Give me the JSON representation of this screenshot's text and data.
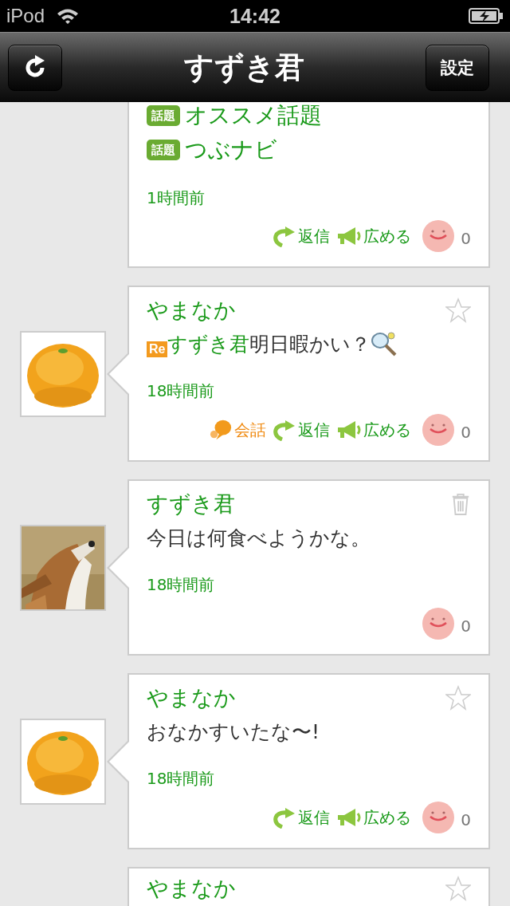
{
  "status_bar": {
    "carrier": "iPod",
    "time": "14:42"
  },
  "nav_bar": {
    "title": "すずき君",
    "settings_button": "設定"
  },
  "posts": [
    {
      "kind": "partial_top",
      "topics": [
        {
          "badge": "話題",
          "label": "オススメ話題"
        },
        {
          "badge": "話題",
          "label": "つぶナビ"
        }
      ],
      "time": "1時間前",
      "actions": [
        {
          "kind": "reply",
          "label": "返信"
        },
        {
          "kind": "spread",
          "label": "広める"
        }
      ],
      "likes": "0"
    },
    {
      "kind": "post",
      "author": "やまなか",
      "starred": false,
      "avatar": {
        "kind": "picture"
      },
      "re_badge": "Re",
      "reply_to": "すずき君",
      "text": "明日暇かい？",
      "racket_emoji": true,
      "time": "18時間前",
      "actions": [
        {
          "kind": "conversation",
          "label": "会話"
        },
        {
          "kind": "reply",
          "label": "返信"
        },
        {
          "kind": "spread",
          "label": "広める"
        }
      ],
      "likes": "0"
    },
    {
      "kind": "post",
      "author": "すずき君",
      "deletable": true,
      "avatar": {
        "kind": "picture"
      },
      "text": "今日は何食べようかな。",
      "time": "18時間前",
      "likes": "0"
    },
    {
      "kind": "post",
      "author": "やまなか",
      "starred": false,
      "avatar": {
        "kind": "picture"
      },
      "text": "おなかすいたな〜!",
      "time": "18時間前",
      "actions": [
        {
          "kind": "reply",
          "label": "返信"
        },
        {
          "kind": "spread",
          "label": "広める"
        }
      ],
      "likes": "0"
    },
    {
      "kind": "partial_bottom",
      "author": "やまなか",
      "starred": false
    }
  ]
}
